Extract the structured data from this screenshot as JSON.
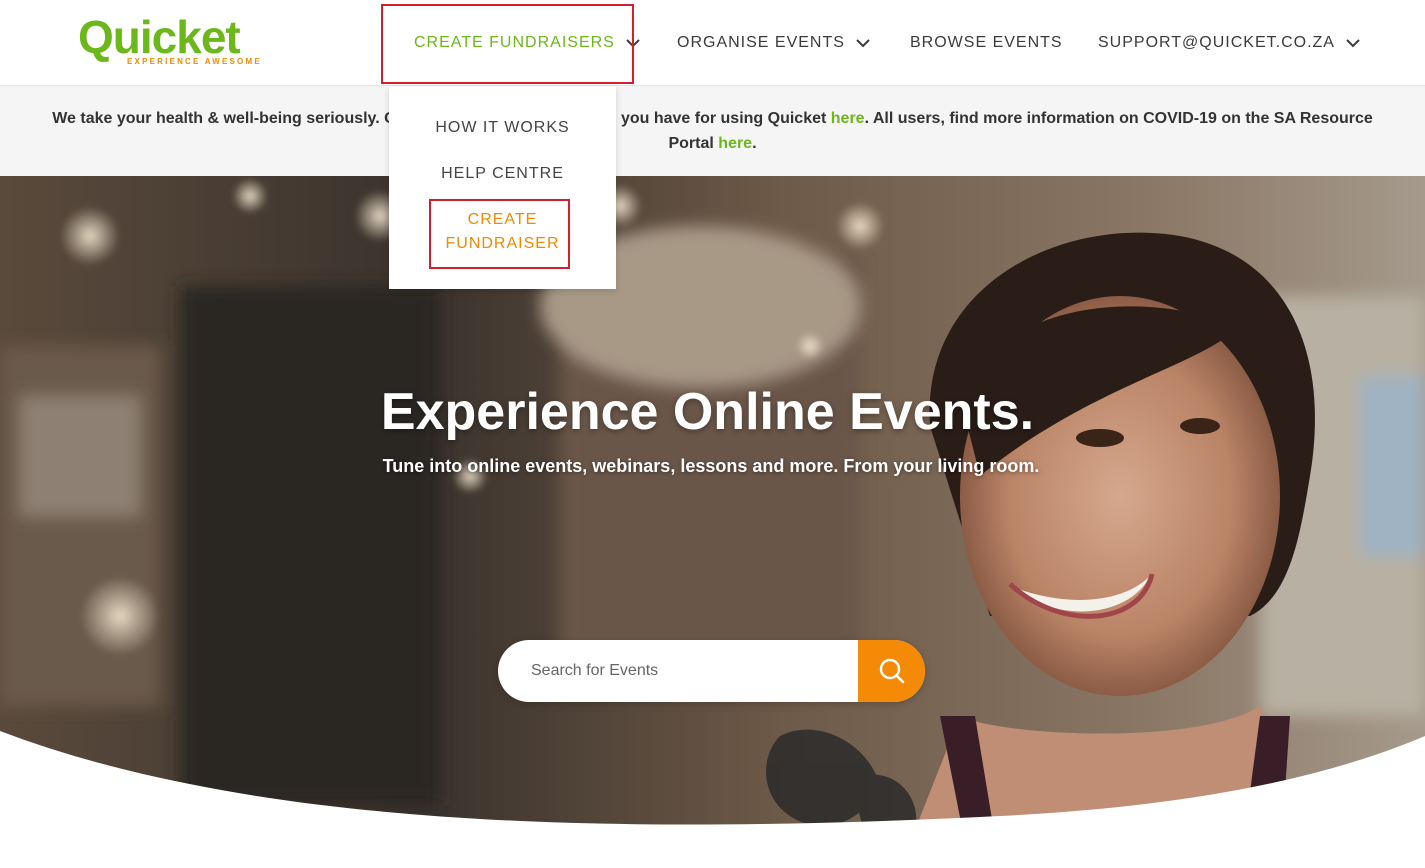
{
  "brand": {
    "name": "Quicket",
    "tagline": "EXPERIENCE AWESOME",
    "green": "#6cb71b",
    "orange": "#f58a07"
  },
  "nav": {
    "create_fundraisers": "CREATE FUNDRAISERS",
    "organise_events": "ORGANISE EVENTS",
    "browse_events": "BROWSE EVENTS",
    "support": "SUPPORT@QUICKET.CO.ZA"
  },
  "dropdown": {
    "how_it_works": "HOW IT WORKS",
    "help_centre": "HELP CENTRE",
    "create_fundraiser_line1": "CREATE",
    "create_fundraiser_line2": "FUNDRAISER"
  },
  "notice": {
    "text_before_dropdown": "We take your health & well-being seriously. Or",
    "text_after_dropdown": "ns you have for using Quicket ",
    "link1": "here",
    "text_middle": ". All users, find more information on COVID-19 on the SA Resource Portal ",
    "link2": "here",
    "text_end": "."
  },
  "hero": {
    "title": "Experience Online Events.",
    "subtitle": "Tune into online events, webinars, lessons and more. From your living room."
  },
  "search": {
    "placeholder": "Search for Events",
    "button_icon": "search-icon"
  },
  "annotations": {
    "highlight_color": "#d2202f"
  }
}
